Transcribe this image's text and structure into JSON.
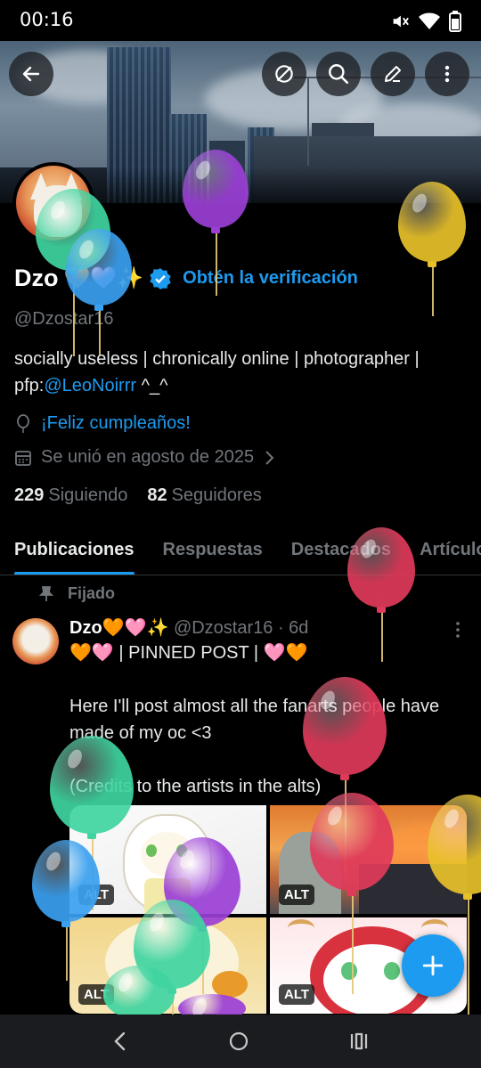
{
  "status_bar": {
    "time": "00:16",
    "icons": [
      "mute-icon",
      "wifi-icon",
      "battery-icon"
    ]
  },
  "header": {
    "buttons": [
      "back-arrow-icon",
      "hide-icon",
      "search-icon",
      "edit-icon",
      "more-vertical-icon"
    ]
  },
  "profile": {
    "display_name": "Dzo",
    "name_emojis": "🧡🩷✨",
    "verification_cta": "Obtén la verificación",
    "handle": "@Dzostar16",
    "bio_text": "socially useless | chronically online | photographer | pfp:",
    "bio_mention": "@LeoNoirrr",
    "bio_suffix": " ^_^",
    "birthday": "¡Feliz cumpleaños!",
    "joined": "Se unió en agosto de 2025",
    "following_count": "229",
    "following_label": "Siguiendo",
    "followers_count": "82",
    "followers_label": "Seguidores"
  },
  "tabs": [
    {
      "label": "Publicaciones",
      "active": true
    },
    {
      "label": "Respuestas",
      "active": false
    },
    {
      "label": "Destacados",
      "active": false
    },
    {
      "label": "Artículos",
      "active": false
    }
  ],
  "post": {
    "pinned_label": "Fijado",
    "author_name": "Dzo🧡🩷✨",
    "author_handle": "@Dzostar16",
    "age": "· 6d",
    "text": "🧡🩷 | PINNED POST | 🩷🧡\n\nHere I'll post almost all the fanarts people have made of my oc <3\n\n(Credits to the artists in the alts)",
    "media": [
      {
        "alt": "ALT"
      },
      {
        "alt": "ALT"
      },
      {
        "alt": "ALT"
      },
      {
        "alt": "ALT"
      }
    ]
  },
  "colors": {
    "accent": "#1d9bf0",
    "background": "#000000",
    "muted_text": "#71767b",
    "balloon_purple": "#9b3fd6",
    "balloon_green": "#3fd4a0",
    "balloon_blue": "#3aa0f0",
    "balloon_yellow": "#e8c12a",
    "balloon_red": "#e03a5a"
  },
  "nav_bar": {
    "icons": [
      "back-chevron-icon",
      "home-circle-icon",
      "recents-icon"
    ]
  }
}
